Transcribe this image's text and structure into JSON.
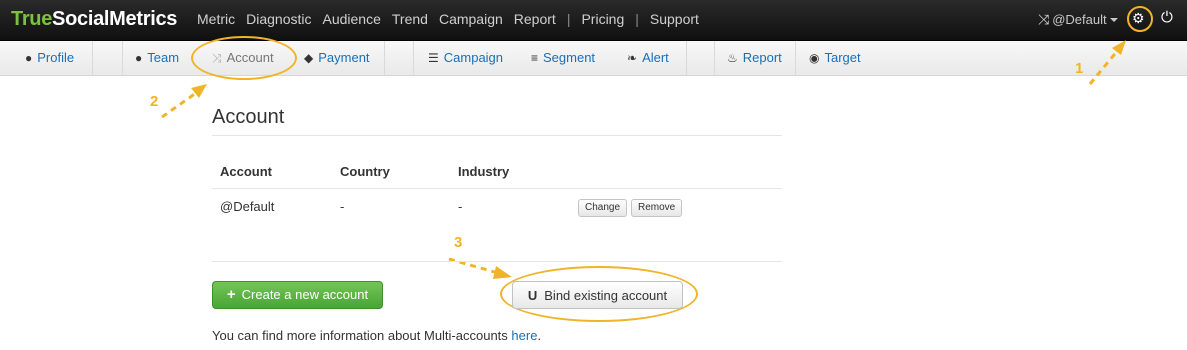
{
  "brand": {
    "part1": "True",
    "part2": "SocialMetrics"
  },
  "topnav": {
    "items": [
      "Metric",
      "Diagnostic",
      "Audience",
      "Trend",
      "Campaign",
      "Report"
    ],
    "separator": "|",
    "extra_items": [
      "Pricing",
      "Support"
    ]
  },
  "account_switch": {
    "icon": "shuffle-icon",
    "label": "@Default"
  },
  "subnav": {
    "tabs": [
      {
        "label": "Profile",
        "icon": "user-icon"
      },
      {
        "label": "Team",
        "icon": "user-icon"
      },
      {
        "label": "Account",
        "icon": "shuffle-icon",
        "active": true
      },
      {
        "label": "Payment",
        "icon": "tag-icon"
      },
      {
        "label": "Campaign",
        "icon": "list-icon"
      },
      {
        "label": "Segment",
        "icon": "lines-icon"
      },
      {
        "label": "Alert",
        "icon": "leaf-icon"
      },
      {
        "label": "Report",
        "icon": "fire-icon"
      },
      {
        "label": "Target",
        "icon": "eye-icon"
      }
    ]
  },
  "annotations": [
    "1",
    "2",
    "3"
  ],
  "page": {
    "title": "Account",
    "table": {
      "headers": [
        "Account",
        "Country",
        "Industry"
      ],
      "rows": [
        {
          "account": "@Default",
          "country": "-",
          "industry": "-",
          "change_label": "Change",
          "remove_label": "Remove"
        }
      ]
    },
    "create_button": "Create a new account",
    "bind_button": "Bind existing account",
    "info_text": "You can find more information about Multi-accounts ",
    "info_link": "here",
    "info_end": "."
  },
  "colors": {
    "accent": "#f0b429",
    "brand_green": "#7ac143",
    "link": "#1a6fb8",
    "button_green": "#5cb346"
  }
}
